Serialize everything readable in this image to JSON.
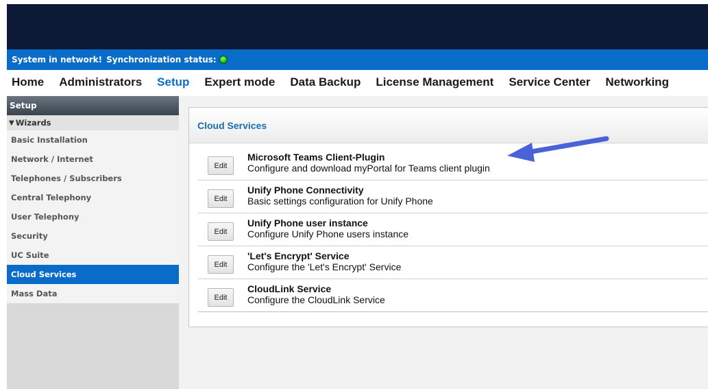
{
  "status": {
    "text": "System in network!",
    "sync_label": "Synchronization status:",
    "sync_color": "#1fbf1a"
  },
  "nav": {
    "items": [
      {
        "label": "Home",
        "active": false
      },
      {
        "label": "Administrators",
        "active": false
      },
      {
        "label": "Setup",
        "active": true
      },
      {
        "label": "Expert mode",
        "active": false
      },
      {
        "label": "Data Backup",
        "active": false
      },
      {
        "label": "License Management",
        "active": false
      },
      {
        "label": "Service Center",
        "active": false
      },
      {
        "label": "Networking",
        "active": false
      }
    ]
  },
  "sidebar": {
    "header": "Setup",
    "section": "Wizards",
    "items": [
      {
        "label": "Basic Installation"
      },
      {
        "label": "Network / Internet"
      },
      {
        "label": "Telephones / Subscribers"
      },
      {
        "label": "Central Telephony"
      },
      {
        "label": "User Telephony"
      },
      {
        "label": "Security"
      },
      {
        "label": "UC Suite"
      },
      {
        "label": "Cloud Services"
      },
      {
        "label": "Mass Data"
      }
    ],
    "active_item": "Cloud Services"
  },
  "panel": {
    "title": "Cloud Services",
    "edit_label": "Edit",
    "services": [
      {
        "title": "Microsoft Teams Client-Plugin",
        "desc": "Configure and download myPortal for Teams client plugin"
      },
      {
        "title": "Unify Phone Connectivity",
        "desc": "Basic settings configuration for Unify Phone"
      },
      {
        "title": "Unify Phone user instance",
        "desc": "Configure Unify Phone users instance"
      },
      {
        "title": "'Let's Encrypt' Service",
        "desc": "Configure the 'Let's Encrypt' Service"
      },
      {
        "title": "CloudLink Service",
        "desc": "Configure the CloudLink Service"
      }
    ]
  },
  "colors": {
    "brand_dark": "#0c1a38",
    "accent_blue": "#0a6cc9",
    "panel_title": "#1b6bb0",
    "annotation_arrow": "#4a62d8"
  },
  "annotation": {
    "icon": "arrow-icon"
  }
}
